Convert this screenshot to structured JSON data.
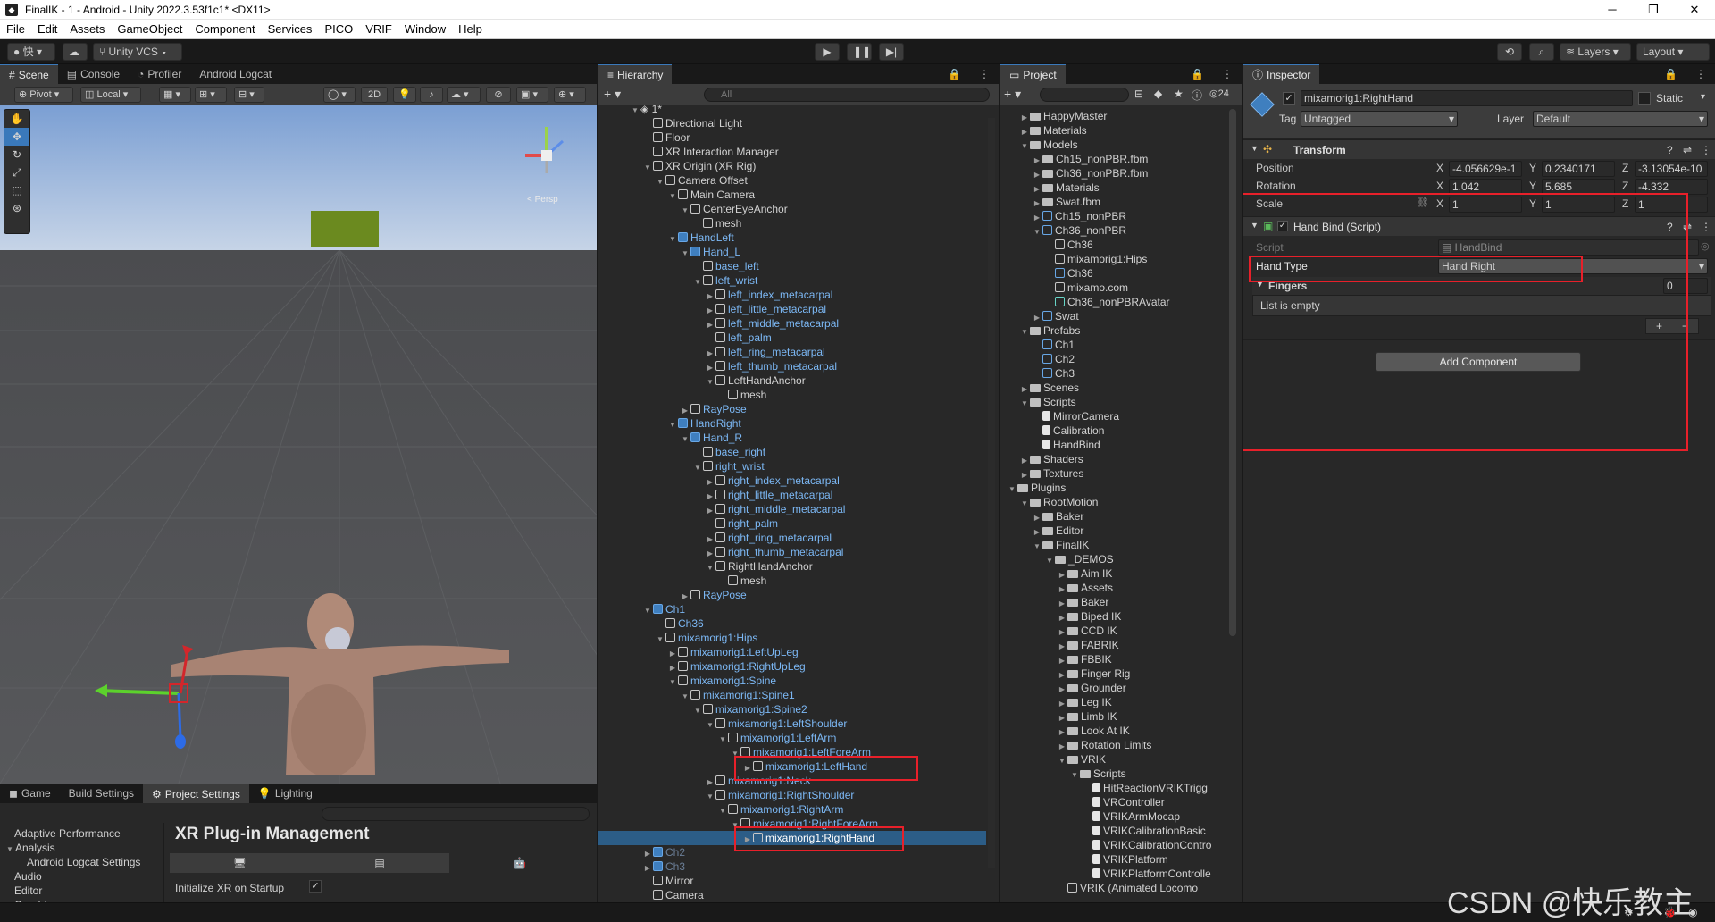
{
  "window": {
    "title": "FinalIK - 1 - Android - Unity 2022.3.53f1c1* <DX11>"
  },
  "menu": [
    "File",
    "Edit",
    "Assets",
    "GameObject",
    "Component",
    "Services",
    "PICO",
    "VRIF",
    "Window",
    "Help"
  ],
  "toolbar": {
    "account": "快",
    "vcs": "Unity VCS",
    "layers": "Layers",
    "layout": "Layout"
  },
  "scene_panel": {
    "tabs": [
      "Scene",
      "Console",
      "Profiler",
      "Android Logcat"
    ],
    "pivot": "Pivot",
    "local": "Local",
    "mode2d": "2D",
    "gizmo_label": "< Persp"
  },
  "bottom_panel": {
    "tabs": [
      "Game",
      "Build Settings",
      "Project Settings",
      "Lighting"
    ],
    "settings_list": [
      "Adaptive Performance",
      "Analysis",
      "Android Logcat Settings",
      "Audio",
      "Editor",
      "Graphics"
    ],
    "heading": "XR Plug-in Management",
    "init_xr_label": "Initialize XR on Startup",
    "init_xr_checked": true
  },
  "hierarchy": {
    "tab": "Hierarchy",
    "search_placeholder": "All",
    "scene": "1*",
    "rows": [
      {
        "text": "Directional Light",
        "depth": 1,
        "style": "normal"
      },
      {
        "text": "Floor",
        "depth": 1,
        "style": "normal"
      },
      {
        "text": "XR Interaction Manager",
        "depth": 1,
        "style": "normal"
      },
      {
        "text": "XR Origin (XR Rig)",
        "depth": 1,
        "style": "normal",
        "expanded": true
      },
      {
        "text": "Camera Offset",
        "depth": 2,
        "style": "normal",
        "expanded": true
      },
      {
        "text": "Main Camera",
        "depth": 3,
        "style": "normal",
        "expanded": true
      },
      {
        "text": "CenterEyeAnchor",
        "depth": 4,
        "style": "normal",
        "expanded": true
      },
      {
        "text": "mesh",
        "depth": 5,
        "style": "normal"
      },
      {
        "text": "HandLeft",
        "depth": 3,
        "style": "blue",
        "expanded": true,
        "prefab": true
      },
      {
        "text": "Hand_L",
        "depth": 4,
        "style": "blue",
        "expanded": true,
        "prefab": true
      },
      {
        "text": "base_left",
        "depth": 5,
        "style": "blue"
      },
      {
        "text": "left_wrist",
        "depth": 5,
        "style": "blue",
        "expanded": true
      },
      {
        "text": "left_index_metacarpal",
        "depth": 6,
        "style": "blue",
        "collapsed": true
      },
      {
        "text": "left_little_metacarpal",
        "depth": 6,
        "style": "blue",
        "collapsed": true
      },
      {
        "text": "left_middle_metacarpal",
        "depth": 6,
        "style": "blue",
        "collapsed": true
      },
      {
        "text": "left_palm",
        "depth": 6,
        "style": "blue"
      },
      {
        "text": "left_ring_metacarpal",
        "depth": 6,
        "style": "blue",
        "collapsed": true
      },
      {
        "text": "left_thumb_metacarpal",
        "depth": 6,
        "style": "blue",
        "collapsed": true
      },
      {
        "text": "LeftHandAnchor",
        "depth": 6,
        "style": "normal",
        "expanded": true
      },
      {
        "text": "mesh",
        "depth": 7,
        "style": "normal"
      },
      {
        "text": "RayPose",
        "depth": 4,
        "style": "blue",
        "collapsed": true
      },
      {
        "text": "HandRight",
        "depth": 3,
        "style": "blue",
        "expanded": true,
        "prefab": true
      },
      {
        "text": "Hand_R",
        "depth": 4,
        "style": "blue",
        "expanded": true,
        "prefab": true
      },
      {
        "text": "base_right",
        "depth": 5,
        "style": "blue"
      },
      {
        "text": "right_wrist",
        "depth": 5,
        "style": "blue",
        "expanded": true
      },
      {
        "text": "right_index_metacarpal",
        "depth": 6,
        "style": "blue",
        "collapsed": true
      },
      {
        "text": "right_little_metacarpal",
        "depth": 6,
        "style": "blue",
        "collapsed": true
      },
      {
        "text": "right_middle_metacarpal",
        "depth": 6,
        "style": "blue",
        "collapsed": true
      },
      {
        "text": "right_palm",
        "depth": 6,
        "style": "blue"
      },
      {
        "text": "right_ring_metacarpal",
        "depth": 6,
        "style": "blue",
        "collapsed": true
      },
      {
        "text": "right_thumb_metacarpal",
        "depth": 6,
        "style": "blue",
        "collapsed": true
      },
      {
        "text": "RightHandAnchor",
        "depth": 6,
        "style": "normal",
        "expanded": true
      },
      {
        "text": "mesh",
        "depth": 7,
        "style": "normal"
      },
      {
        "text": "RayPose",
        "depth": 4,
        "style": "blue",
        "collapsed": true
      },
      {
        "text": "Ch1",
        "depth": 1,
        "style": "blue",
        "expanded": true,
        "prefab": true
      },
      {
        "text": "Ch36",
        "depth": 2,
        "style": "blue"
      },
      {
        "text": "mixamorig1:Hips",
        "depth": 2,
        "style": "blue",
        "expanded": true
      },
      {
        "text": "mixamorig1:LeftUpLeg",
        "depth": 3,
        "style": "blue",
        "collapsed": true
      },
      {
        "text": "mixamorig1:RightUpLeg",
        "depth": 3,
        "style": "blue",
        "collapsed": true
      },
      {
        "text": "mixamorig1:Spine",
        "depth": 3,
        "style": "blue",
        "expanded": true
      },
      {
        "text": "mixamorig1:Spine1",
        "depth": 4,
        "style": "blue",
        "expanded": true
      },
      {
        "text": "mixamorig1:Spine2",
        "depth": 5,
        "style": "blue",
        "expanded": true
      },
      {
        "text": "mixamorig1:LeftShoulder",
        "depth": 6,
        "style": "blue",
        "expanded": true
      },
      {
        "text": "mixamorig1:LeftArm",
        "depth": 7,
        "style": "blue",
        "expanded": true
      },
      {
        "text": "mixamorig1:LeftForeArm",
        "depth": 8,
        "style": "blue",
        "expanded": true
      },
      {
        "text": "mixamorig1:LeftHand",
        "depth": 9,
        "style": "blue",
        "collapsed": true
      },
      {
        "text": "mixamorig1:Neck",
        "depth": 6,
        "style": "blue",
        "collapsed": true
      },
      {
        "text": "mixamorig1:RightShoulder",
        "depth": 6,
        "style": "blue",
        "expanded": true
      },
      {
        "text": "mixamorig1:RightArm",
        "depth": 7,
        "style": "blue",
        "expanded": true
      },
      {
        "text": "mixamorig1:RightForeArm",
        "depth": 8,
        "style": "blue",
        "expanded": true
      },
      {
        "text": "mixamorig1:RightHand",
        "depth": 9,
        "style": "selected",
        "collapsed": true
      },
      {
        "text": "Ch2",
        "depth": 1,
        "style": "dim",
        "collapsed": true,
        "prefab": true
      },
      {
        "text": "Ch3",
        "depth": 1,
        "style": "dim",
        "collapsed": true,
        "prefab": true
      },
      {
        "text": "Mirror",
        "depth": 1,
        "style": "normal"
      },
      {
        "text": "Camera",
        "depth": 1,
        "style": "normal"
      }
    ]
  },
  "project": {
    "tab": "Project",
    "hidden_count": "24",
    "rows": [
      {
        "text": "HappyMaster",
        "depth": 1,
        "kind": "folder"
      },
      {
        "text": "Materials",
        "depth": 1,
        "kind": "folder"
      },
      {
        "text": "Models",
        "depth": 1,
        "kind": "folder",
        "expanded": true
      },
      {
        "text": "Ch15_nonPBR.fbm",
        "depth": 2,
        "kind": "folder"
      },
      {
        "text": "Ch36_nonPBR.fbm",
        "depth": 2,
        "kind": "folder"
      },
      {
        "text": "Materials",
        "depth": 2,
        "kind": "folder"
      },
      {
        "text": "Swat.fbm",
        "depth": 2,
        "kind": "folder"
      },
      {
        "text": "Ch15_nonPBR",
        "depth": 2,
        "kind": "model"
      },
      {
        "text": "Ch36_nonPBR",
        "depth": 2,
        "kind": "model",
        "expanded": true
      },
      {
        "text": "Ch36",
        "depth": 3,
        "kind": "mesh"
      },
      {
        "text": "mixamorig1:Hips",
        "depth": 3,
        "kind": "mesh"
      },
      {
        "text": "Ch36",
        "depth": 3,
        "kind": "grid"
      },
      {
        "text": "mixamo.com",
        "depth": 3,
        "kind": "anim"
      },
      {
        "text": "Ch36_nonPBRAvatar",
        "depth": 3,
        "kind": "avatar"
      },
      {
        "text": "Swat",
        "depth": 2,
        "kind": "model"
      },
      {
        "text": "Prefabs",
        "depth": 1,
        "kind": "folder",
        "expanded": true
      },
      {
        "text": "Ch1",
        "depth": 2,
        "kind": "prefab"
      },
      {
        "text": "Ch2",
        "depth": 2,
        "kind": "prefab"
      },
      {
        "text": "Ch3",
        "depth": 2,
        "kind": "prefab"
      },
      {
        "text": "Scenes",
        "depth": 1,
        "kind": "folder"
      },
      {
        "text": "Scripts",
        "depth": 1,
        "kind": "folder",
        "expanded": true
      },
      {
        "text": "MirrorCamera",
        "depth": 2,
        "kind": "script"
      },
      {
        "text": "Calibration",
        "depth": 2,
        "kind": "script"
      },
      {
        "text": "HandBind",
        "depth": 2,
        "kind": "script"
      },
      {
        "text": "Shaders",
        "depth": 1,
        "kind": "folder"
      },
      {
        "text": "Textures",
        "depth": 1,
        "kind": "folder"
      },
      {
        "text": "Plugins",
        "depth": 0,
        "kind": "folder",
        "expanded": true
      },
      {
        "text": "RootMotion",
        "depth": 1,
        "kind": "folder",
        "expanded": true
      },
      {
        "text": "Baker",
        "depth": 2,
        "kind": "folder"
      },
      {
        "text": "Editor",
        "depth": 2,
        "kind": "folder"
      },
      {
        "text": "FinalIK",
        "depth": 2,
        "kind": "folder",
        "expanded": true
      },
      {
        "text": "_DEMOS",
        "depth": 3,
        "kind": "folder",
        "expanded": true
      },
      {
        "text": "Aim IK",
        "depth": 4,
        "kind": "folder"
      },
      {
        "text": "Assets",
        "depth": 4,
        "kind": "folder"
      },
      {
        "text": "Baker",
        "depth": 4,
        "kind": "folder"
      },
      {
        "text": "Biped IK",
        "depth": 4,
        "kind": "folder"
      },
      {
        "text": "CCD IK",
        "depth": 4,
        "kind": "folder"
      },
      {
        "text": "FABRIK",
        "depth": 4,
        "kind": "folder"
      },
      {
        "text": "FBBIK",
        "depth": 4,
        "kind": "folder"
      },
      {
        "text": "Finger Rig",
        "depth": 4,
        "kind": "folder"
      },
      {
        "text": "Grounder",
        "depth": 4,
        "kind": "folder"
      },
      {
        "text": "Leg IK",
        "depth": 4,
        "kind": "folder"
      },
      {
        "text": "Limb IK",
        "depth": 4,
        "kind": "folder"
      },
      {
        "text": "Look At IK",
        "depth": 4,
        "kind": "folder"
      },
      {
        "text": "Rotation Limits",
        "depth": 4,
        "kind": "folder"
      },
      {
        "text": "VRIK",
        "depth": 4,
        "kind": "folder",
        "expanded": true
      },
      {
        "text": "Scripts",
        "depth": 5,
        "kind": "folder",
        "expanded": true
      },
      {
        "text": "HitReactionVRIKTrigg",
        "depth": 6,
        "kind": "script"
      },
      {
        "text": "VRController",
        "depth": 6,
        "kind": "script"
      },
      {
        "text": "VRIKArmMocap",
        "depth": 6,
        "kind": "script"
      },
      {
        "text": "VRIKCalibrationBasic",
        "depth": 6,
        "kind": "script"
      },
      {
        "text": "VRIKCalibrationContro",
        "depth": 6,
        "kind": "script"
      },
      {
        "text": "VRIKPlatform",
        "depth": 6,
        "kind": "script"
      },
      {
        "text": "VRIKPlatformControlle",
        "depth": 6,
        "kind": "script"
      },
      {
        "text": "VRIK (Animated Locomo",
        "depth": 4,
        "kind": "scene"
      }
    ]
  },
  "inspector": {
    "tab": "Inspector",
    "object_name": "mixamorig1:RightHand",
    "static_label": "Static",
    "tag_label": "Tag",
    "tag_value": "Untagged",
    "layer_label": "Layer",
    "layer_value": "Default",
    "transform": {
      "title": "Transform",
      "position_label": "Position",
      "position": [
        "-4.056629e-1",
        "0.2340171",
        "-3.13054e-10"
      ],
      "rotation_label": "Rotation",
      "rotation": [
        "1.042",
        "5.685",
        "-4.332"
      ],
      "scale_label": "Scale",
      "scale": [
        "1",
        "1",
        "1"
      ]
    },
    "handbind": {
      "title": "Hand Bind (Script)",
      "script_label": "Script",
      "script_value": "HandBind",
      "handtype_label": "Hand Type",
      "handtype_value": "Hand Right",
      "fingers_label": "Fingers",
      "fingers_count": "0",
      "list_empty": "List is empty"
    },
    "add_component": "Add Component"
  },
  "watermark": "CSDN @快乐教主"
}
